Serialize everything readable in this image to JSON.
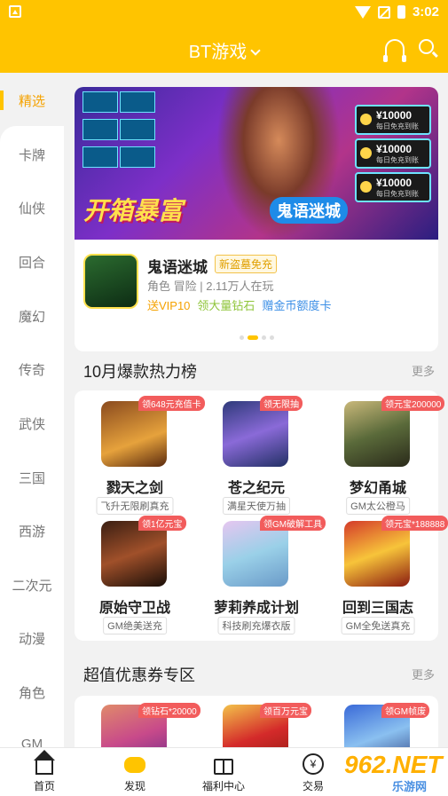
{
  "status": {
    "time": "3:02"
  },
  "header": {
    "title": "BT游戏"
  },
  "sidebar": {
    "items": [
      "精选",
      "卡牌",
      "仙侠",
      "回合",
      "魔幻",
      "传奇",
      "武侠",
      "三国",
      "西游",
      "二次元",
      "动漫",
      "角色",
      "GM"
    ]
  },
  "banner": {
    "slogan": "开箱暴富",
    "brand": "鬼语迷城",
    "coin_amount": "¥10000",
    "coin_sub": "每日免充到账",
    "game_name": "鬼语迷城",
    "tag": "新盗墓免充",
    "meta": "角色 冒险 | 2.11万人在玩",
    "perks": [
      "送VIP10",
      "领大量钻石",
      "赠金币额度卡"
    ]
  },
  "section1": {
    "title": "10月爆款热力榜",
    "more": "更多"
  },
  "hot_games": [
    {
      "name": "戮天之剑",
      "sub": "飞升无限刷真充",
      "badge": "领648元充值卡"
    },
    {
      "name": "苍之纪元",
      "sub": "满星天使万抽",
      "badge": "领无限抽"
    },
    {
      "name": "梦幻甬城",
      "sub": "GM太公橙马",
      "badge": "领元宝200000"
    },
    {
      "name": "原始守卫战",
      "sub": "GM绝美送充",
      "badge": "领1亿元宝"
    },
    {
      "name": "萝莉养成计划",
      "sub": "科技刷充爆衣版",
      "badge": "领GM破解工具"
    },
    {
      "name": "回到三国志",
      "sub": "GM全免送真充",
      "badge": "领元宝*188888"
    }
  ],
  "section2": {
    "title": "超值优惠券专区",
    "more": "更多"
  },
  "coupon_games": [
    {
      "badge": "领钻石*20000"
    },
    {
      "badge": "领百万元宝"
    },
    {
      "badge": "领GM帧废"
    }
  ],
  "bottom_nav": [
    "首页",
    "发现",
    "福利中心",
    "交易"
  ],
  "watermark": {
    "main": "962.NET",
    "sub": "乐游网"
  }
}
